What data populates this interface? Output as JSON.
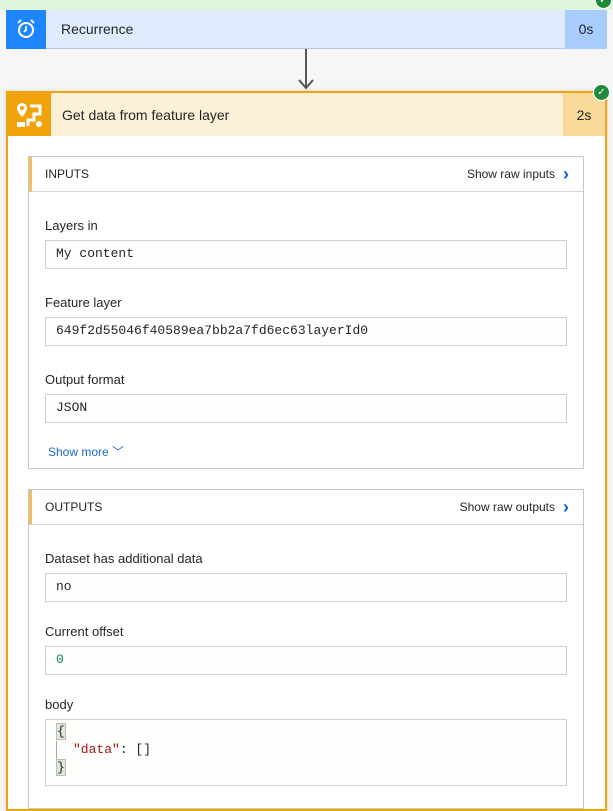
{
  "trigger": {
    "title": "Recurrence",
    "duration": "0s",
    "icon": "alarm-clock-icon"
  },
  "action": {
    "title": "Get data from feature layer",
    "duration": "2s",
    "icon": "map-route-icon",
    "inputs": {
      "header": "INPUTS",
      "raw_label": "Show raw inputs",
      "fields": [
        {
          "label": "Layers in",
          "value": "My content"
        },
        {
          "label": "Feature layer",
          "value": "649f2d55046f40589ea7bb2a7fd6ec63layerId0"
        },
        {
          "label": "Output format",
          "value": "JSON"
        }
      ],
      "show_more": "Show more"
    },
    "outputs": {
      "header": "OUTPUTS",
      "raw_label": "Show raw outputs",
      "fields": [
        {
          "label": "Dataset has additional data",
          "value": "no"
        },
        {
          "label": "Current offset",
          "value": "0"
        }
      ],
      "body": {
        "label": "body",
        "open": "{",
        "key": "\"data\"",
        "sep": ": ",
        "val": "[]",
        "close": "}"
      }
    }
  },
  "colors": {
    "accent": "#f0a30a",
    "success": "#1e8b3a",
    "trigger": "#1f85ff"
  }
}
